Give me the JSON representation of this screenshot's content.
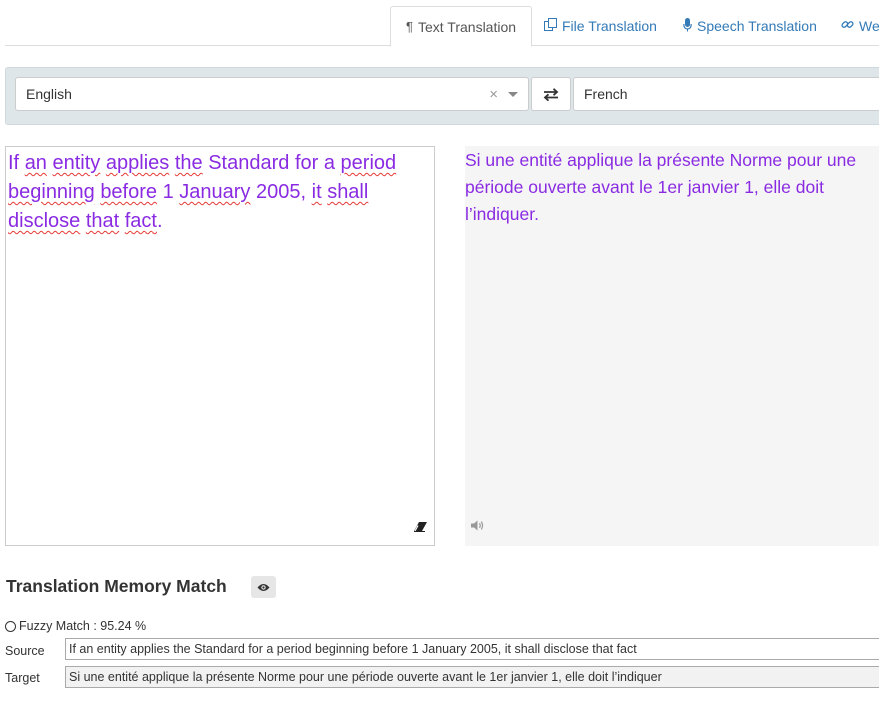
{
  "tabs": [
    {
      "label": "Text Translation",
      "icon": "paragraph-icon",
      "active": true
    },
    {
      "label": "File Translation",
      "icon": "copy-files-icon",
      "active": false
    },
    {
      "label": "Speech Translation",
      "icon": "microphone-icon",
      "active": false
    },
    {
      "label": "Web",
      "icon": "link-icon",
      "active": false
    }
  ],
  "languages": {
    "source": "English",
    "clear_glyph": "×",
    "target": "French"
  },
  "source_text_words": [
    "If",
    "an",
    "entity",
    "applies",
    "the",
    "Standard",
    "for",
    "a",
    "period",
    "beginning",
    "before",
    "1",
    "January",
    "2005,",
    "it",
    "shall",
    "disclose",
    "that",
    "fact."
  ],
  "source_text": "If an entity applies the Standard for a period beginning before 1 January 2005, it shall disclose that fact.",
  "translated_text": "Si une entité applique la présente Norme pour une période ouverte avant le 1er janvier 1, elle doit l’indiquer.",
  "tm": {
    "title": "Translation Memory Match",
    "fuzzy_label": "Fuzzy Match : 95.24 %",
    "source_label": "Source",
    "source_value": "If an entity applies the Standard for a period beginning before 1 January 2005, it shall disclose that fact",
    "target_label": "Target",
    "target_value": "Si une entité applique la présente Norme pour une période ouverte avant le 1er janvier 1, elle doit l’indiquer"
  },
  "colors": {
    "text_purple": "#8a2be2",
    "tab_link": "#337ab7",
    "spell_underline": "#e53935"
  }
}
